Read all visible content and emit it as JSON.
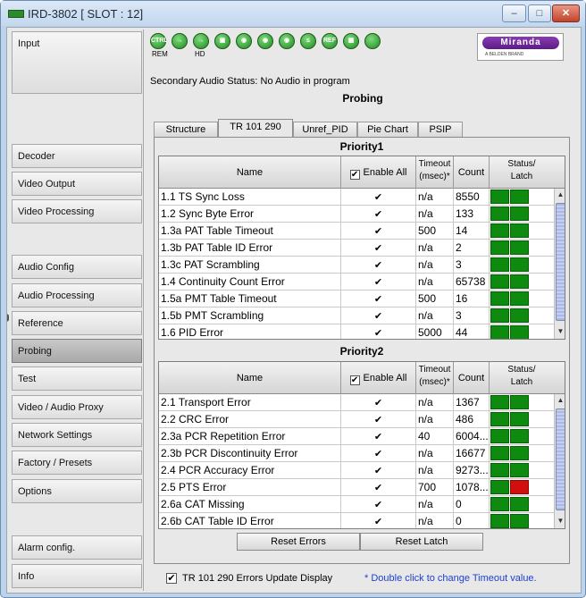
{
  "window": {
    "title": "IRD-3802 [ SLOT : 12]",
    "controls": {
      "minimize": "–",
      "maximize": "□",
      "close": "✕"
    }
  },
  "sidebar": {
    "items": [
      {
        "label": "Input"
      },
      {
        "label": "Decoder"
      },
      {
        "label": "Video Output"
      },
      {
        "label": "Video Processing"
      },
      {
        "label": "Audio Config"
      },
      {
        "label": "Audio Processing"
      },
      {
        "label": "Reference"
      },
      {
        "label": "Probing",
        "active": true
      },
      {
        "label": "Test"
      },
      {
        "label": "Video / Audio Proxy"
      },
      {
        "label": "Network Settings"
      },
      {
        "label": "Factory / Presets"
      },
      {
        "label": "Options"
      },
      {
        "label": "Alarm config."
      },
      {
        "label": "Info"
      }
    ]
  },
  "status_icons": [
    {
      "name": "ctrl-icon",
      "text": "CTRL",
      "caption": "REM"
    },
    {
      "name": "arrow-right-icon",
      "text": "→",
      "caption": ""
    },
    {
      "name": "arrow-right-icon-2",
      "text": "→",
      "caption": "HD"
    },
    {
      "name": "video-icon",
      "text": "▣",
      "caption": ""
    },
    {
      "name": "audio-icon",
      "text": "◉",
      "caption": ""
    },
    {
      "name": "audio-icon-2",
      "text": "◉",
      "caption": ""
    },
    {
      "name": "audio-lock-icon",
      "text": "◉",
      "caption": ""
    },
    {
      "name": "less-icon",
      "text": "≤",
      "caption": ""
    },
    {
      "name": "ref-icon",
      "text": "REF",
      "caption": ""
    },
    {
      "name": "display-icon",
      "text": "▦",
      "caption": ""
    },
    {
      "name": "status-led-icon",
      "text": "",
      "caption": ""
    }
  ],
  "logo": {
    "brand": "Miranda",
    "sub": "A BELDEN BRAND"
  },
  "secondary_audio_status": "Secondary Audio Status: No Audio in program",
  "page_title": "Probing",
  "tabs": [
    {
      "label": "Structure"
    },
    {
      "label": "TR 101 290",
      "selected": true
    },
    {
      "label": "Unref_PID"
    },
    {
      "label": "Pie Chart"
    },
    {
      "label": "PSIP"
    }
  ],
  "table_headers": {
    "name": "Name",
    "enable_all": "Enable All",
    "timeout_line1": "Timeout",
    "timeout_line2": "(msec)*",
    "count": "Count",
    "status_line1": "Status/",
    "status_line2": "Latch"
  },
  "priority1": {
    "title": "Priority1",
    "rows": [
      {
        "name": "1.1 TS Sync Loss",
        "timeout": "n/a",
        "count": "8550",
        "status": "green",
        "latch": "green"
      },
      {
        "name": "1.2 Sync Byte Error",
        "timeout": "n/a",
        "count": "133",
        "status": "green",
        "latch": "green"
      },
      {
        "name": "1.3a PAT Table Timeout",
        "timeout": "500",
        "count": "14",
        "status": "green",
        "latch": "green"
      },
      {
        "name": "1.3b PAT Table ID Error",
        "timeout": "n/a",
        "count": "2",
        "status": "green",
        "latch": "green"
      },
      {
        "name": "1.3c PAT Scrambling",
        "timeout": "n/a",
        "count": "3",
        "status": "green",
        "latch": "green"
      },
      {
        "name": "1.4 Continuity Count Error",
        "timeout": "n/a",
        "count": "65738",
        "status": "green",
        "latch": "green"
      },
      {
        "name": "1.5a PMT Table Timeout",
        "timeout": "500",
        "count": "16",
        "status": "green",
        "latch": "green"
      },
      {
        "name": "1.5b PMT Scrambling",
        "timeout": "n/a",
        "count": "3",
        "status": "green",
        "latch": "green"
      },
      {
        "name": "1.6 PID Error",
        "timeout": "5000",
        "count": "44",
        "status": "green",
        "latch": "green"
      }
    ]
  },
  "priority2": {
    "title": "Priority2",
    "rows": [
      {
        "name": "2.1 Transport Error",
        "timeout": "n/a",
        "count": "1367",
        "status": "green",
        "latch": "green"
      },
      {
        "name": "2.2 CRC Error",
        "timeout": "n/a",
        "count": "486",
        "status": "green",
        "latch": "green"
      },
      {
        "name": "2.3a PCR Repetition Error",
        "timeout": "40",
        "count": "6004...",
        "status": "green",
        "latch": "green"
      },
      {
        "name": "2.3b PCR Discontinuity Error",
        "timeout": "n/a",
        "count": "16677",
        "status": "green",
        "latch": "green"
      },
      {
        "name": "2.4 PCR Accuracy Error",
        "timeout": "n/a",
        "count": "9273...",
        "status": "green",
        "latch": "green"
      },
      {
        "name": "2.5 PTS Error",
        "timeout": "700",
        "count": "1078...",
        "status": "green",
        "latch": "red"
      },
      {
        "name": "2.6a CAT Missing",
        "timeout": "n/a",
        "count": "0",
        "status": "green",
        "latch": "green"
      },
      {
        "name": "2.6b CAT Table ID Error",
        "timeout": "n/a",
        "count": "0",
        "status": "green",
        "latch": "green"
      }
    ]
  },
  "buttons": {
    "reset_errors": "Reset Errors",
    "reset_latch": "Reset Latch"
  },
  "footer": {
    "update_display_label": "TR 101 290 Errors Update Display",
    "update_display_checked": true,
    "timeout_note": "* Double click to change Timeout value."
  },
  "check_mark": "✔",
  "scroll_up": "▲",
  "scroll_down": "▼",
  "colors": {
    "led_green": "#0e8a0e",
    "led_red": "#d10f0f",
    "note_blue": "#1f3fcc",
    "brand_purple": "#6a2596"
  }
}
